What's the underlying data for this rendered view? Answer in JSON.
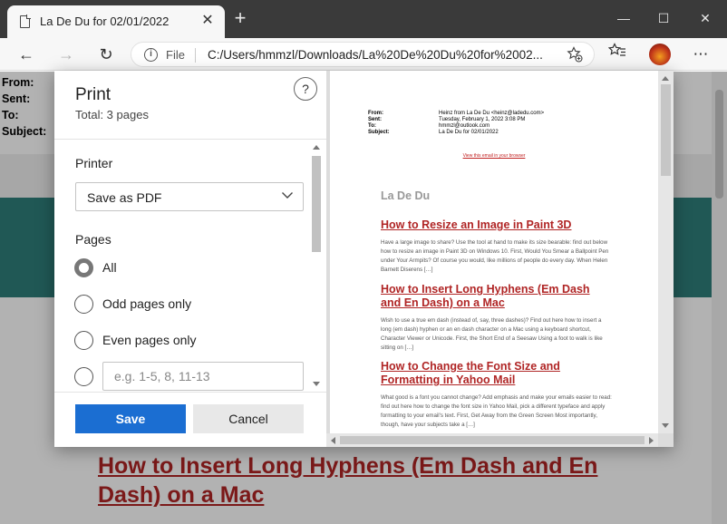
{
  "browser": {
    "tab_title": "La De Du for 02/01/2022",
    "tab_close": "✕",
    "new_tab": "+",
    "window_controls": {
      "minimize": "—",
      "maximize": "☐",
      "close": "✕"
    },
    "nav": {
      "back": "←",
      "forward": "→",
      "reload": "↻"
    },
    "address": {
      "scheme_label": "File",
      "url": "C:/Users/hmmzl/Downloads/La%20De%20Du%20for%2002..."
    },
    "icons": [
      "info-icon",
      "add-favorite-icon",
      "favorites-icon",
      "profile-avatar",
      "more-icon"
    ],
    "more": "⋯",
    "favorites": "☆"
  },
  "page": {
    "email_header_labels": [
      "From:",
      "Sent:",
      "To:",
      "Subject:"
    ],
    "visible_link": "How to Insert Long Hyphens (Em Dash and En Dash) on a Mac",
    "band_color": "#2f7f7a"
  },
  "print": {
    "title": "Print",
    "total": "Total: 3 pages",
    "help": "?",
    "printer_label": "Printer",
    "printer_value": "Save as PDF",
    "pages_label": "Pages",
    "options": [
      {
        "label": "All",
        "checked": true
      },
      {
        "label": "Odd pages only",
        "checked": false
      },
      {
        "label": "Even pages only",
        "checked": false
      }
    ],
    "range_placeholder": "e.g. 1-5, 8, 11-13",
    "save": "Save",
    "cancel": "Cancel",
    "accent": "#1b6ed2"
  },
  "preview": {
    "header": [
      {
        "k": "From:",
        "v": "Heinz from La De Du <heinz@ladedu.com>"
      },
      {
        "k": "Sent:",
        "v": "Tuesday, February 1, 2022 3:08 PM"
      },
      {
        "k": "To:",
        "v": "hmmzl@outlook.com"
      },
      {
        "k": "Subject:",
        "v": "La De Du for 02/01/2022"
      }
    ],
    "view_link": "View this email in your browser",
    "brand": "La De Du",
    "articles": [
      {
        "title": "How to Resize an Image in Paint 3D",
        "body": "Have a large image to share? Use the tool at hand to make its size bearable: find out below how to resize an image in Paint 3D on Windows 10. First, Would You Smear a Ballpoint Pen under Your Armpits? Of course you would, like millions of people do every day. When Helen Barnett Diserens […]"
      },
      {
        "title": "How to Insert Long Hyphens (Em Dash and En Dash) on a Mac",
        "body": "Wish to use a true em dash (instead of, say, three dashes)? Find out here how to insert a long (em dash) hyphen or an en dash character on a Mac using a keyboard shortcut, Character Viewer or Unicode. First, the Short End of a Seesaw Using a foot to walk is like sitting on […]"
      },
      {
        "title": "How to Change the Font Size and Formatting in Yahoo Mail",
        "body": "What good is a font you cannot change? Add emphasis and make your emails easier to read: find out here how to change the font size in Yahoo Mail, pick a different typeface and apply formatting to your email's text. First, Get Away from the Green Screen Most importantly, though, have your subjects take a […]"
      }
    ]
  }
}
